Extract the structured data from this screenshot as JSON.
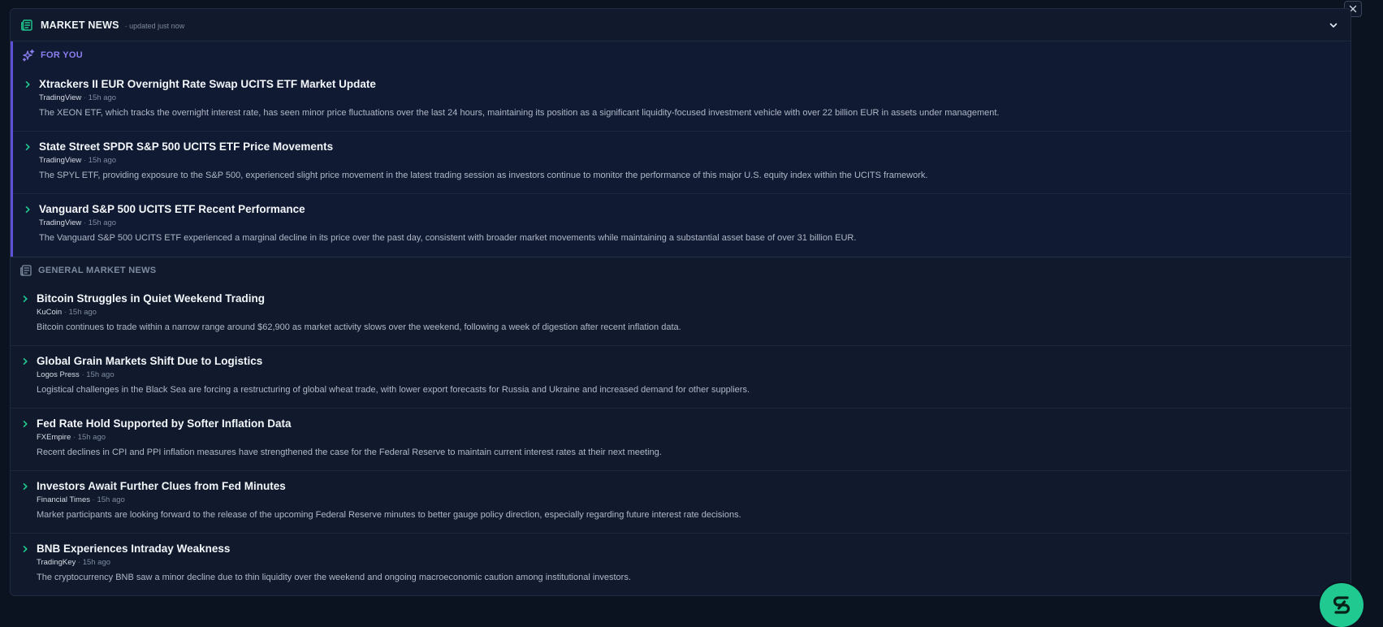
{
  "header": {
    "title": "MARKET NEWS",
    "updated": "updated just now",
    "icon": "newspaper-icon"
  },
  "for_you": {
    "label": "FOR YOU",
    "icon": "sparkles-icon",
    "accent": "#8b7ff0",
    "items": [
      {
        "title": "Xtrackers II EUR Overnight Rate Swap UCITS ETF Market Update",
        "source": "TradingView",
        "time": "15h ago",
        "summary": "The XEON ETF, which tracks the overnight interest rate, has seen minor price fluctuations over the last 24 hours, maintaining its position as a significant liquidity-focused investment vehicle with over 22 billion EUR in assets under management."
      },
      {
        "title": "State Street SPDR S&P 500 UCITS ETF Price Movements",
        "source": "TradingView",
        "time": "15h ago",
        "summary": "The SPYL ETF, providing exposure to the S&P 500, experienced slight price movement in the latest trading session as investors continue to monitor the performance of this major U.S. equity index within the UCITS framework."
      },
      {
        "title": "Vanguard S&P 500 UCITS ETF Recent Performance",
        "source": "TradingView",
        "time": "15h ago",
        "summary": "The Vanguard S&P 500 UCITS ETF experienced a marginal decline in its price over the past day, consistent with broader market movements while maintaining a substantial asset base of over 31 billion EUR."
      }
    ]
  },
  "general": {
    "label": "GENERAL MARKET NEWS",
    "icon": "newspaper-icon",
    "items": [
      {
        "title": "Bitcoin Struggles in Quiet Weekend Trading",
        "source": "KuCoin",
        "time": "15h ago",
        "summary": "Bitcoin continues to trade within a narrow range around $62,900 as market activity slows over the weekend, following a week of digestion after recent inflation data."
      },
      {
        "title": "Global Grain Markets Shift Due to Logistics",
        "source": "Logos Press",
        "time": "15h ago",
        "summary": "Logistical challenges in the Black Sea are forcing a restructuring of global wheat trade, with lower export forecasts for Russia and Ukraine and increased demand for other suppliers."
      },
      {
        "title": "Fed Rate Hold Supported by Softer Inflation Data",
        "source": "FXEmpire",
        "time": "15h ago",
        "summary": "Recent declines in CPI and PPI inflation measures have strengthened the case for the Federal Reserve to maintain current interest rates at their next meeting."
      },
      {
        "title": "Investors Await Further Clues from Fed Minutes",
        "source": "Financial Times",
        "time": "15h ago",
        "summary": "Market participants are looking forward to the release of the upcoming Federal Reserve minutes to better gauge policy direction, especially regarding future interest rate decisions."
      },
      {
        "title": "BNB Experiences Intraday Weakness",
        "source": "TradingKey",
        "time": "15h ago",
        "summary": "The cryptocurrency BNB saw a minor decline due to thin liquidity over the weekend and ongoing macroeconomic caution among institutional investors."
      }
    ]
  },
  "colors": {
    "accent_green": "#1fc98f",
    "accent_purple": "#5e51d8",
    "panel_bg": "#101a2c"
  }
}
